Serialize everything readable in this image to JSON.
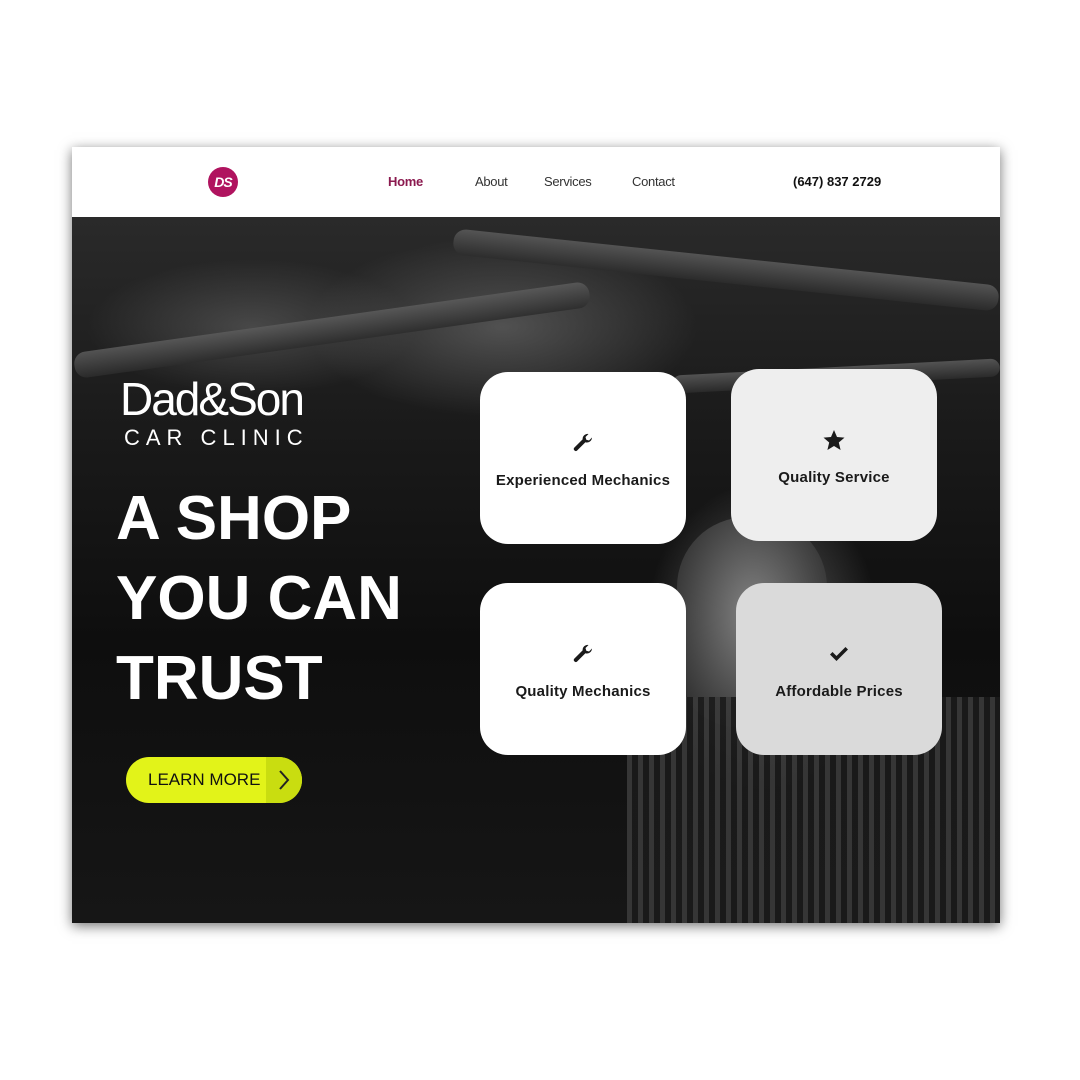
{
  "brand": {
    "logo_text": "DS",
    "name": "Dad&Son",
    "subtitle": "CAR CLINIC",
    "accent": "#b0135f"
  },
  "nav": {
    "items": [
      {
        "label": "Home",
        "active": true
      },
      {
        "label": "About",
        "active": false
      },
      {
        "label": "Services",
        "active": false
      },
      {
        "label": "Contact",
        "active": false
      }
    ],
    "phone": "(647) 837 2729"
  },
  "hero": {
    "headline": [
      "A SHOP",
      "YOU CAN",
      "TRUST"
    ],
    "cta": {
      "label": "LEARN MORE",
      "color": "#e2f319",
      "icon": "chevron-right-icon"
    }
  },
  "features": [
    {
      "label": "Experienced Mechanics",
      "icon": "wrench-icon"
    },
    {
      "label": "Quality Service",
      "icon": "star-icon"
    },
    {
      "label": "Quality Mechanics",
      "icon": "wrench-icon"
    },
    {
      "label": "Affordable Prices",
      "icon": "checkmark-icon"
    }
  ]
}
